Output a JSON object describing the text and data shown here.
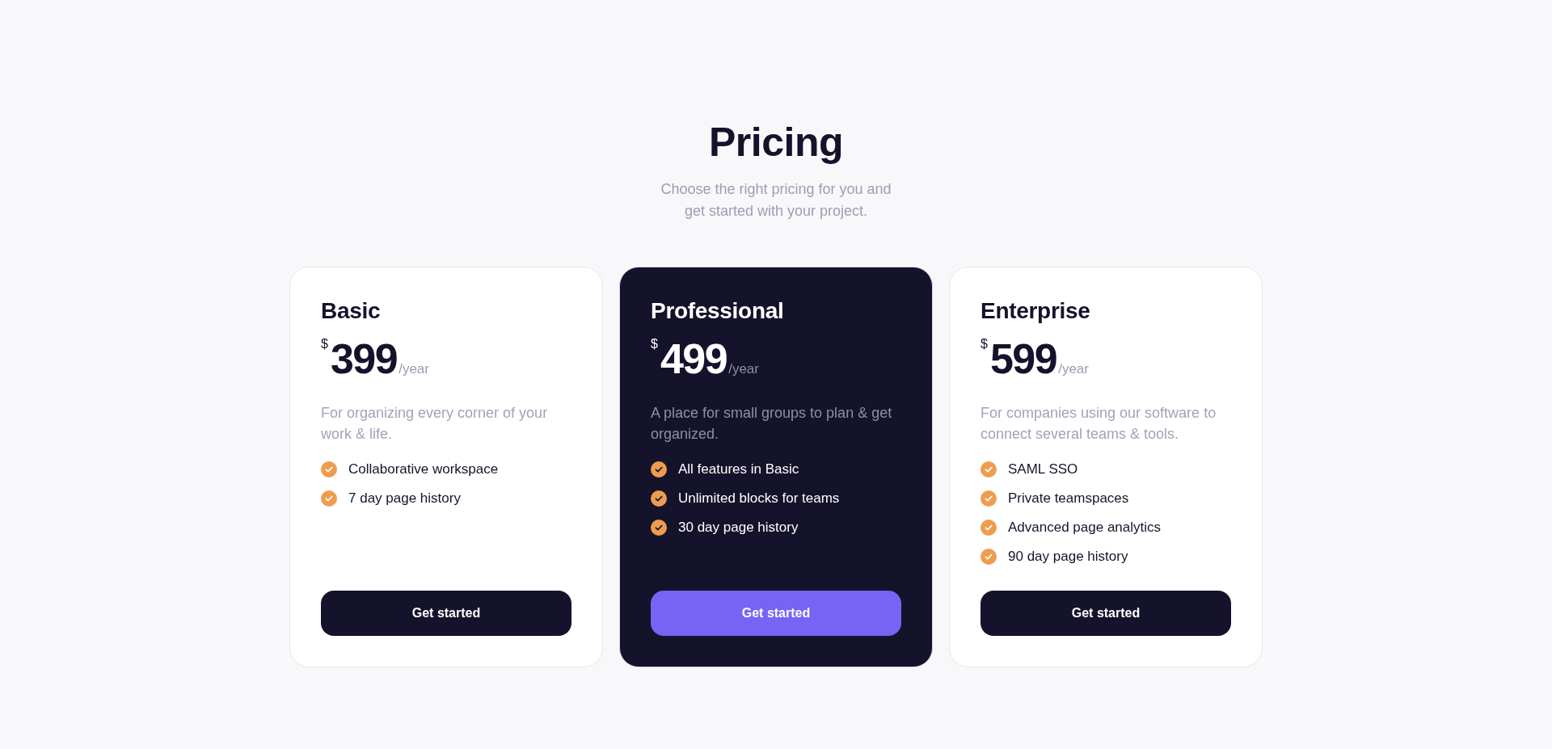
{
  "header": {
    "title": "Pricing",
    "subtitle": "Choose the right pricing for you and get started with your project."
  },
  "plans": [
    {
      "name": "Basic",
      "currency": "$",
      "price": "399",
      "period": "/year",
      "description": "For organizing every corner of your work & life.",
      "features": [
        "Collaborative workspace",
        "7 day page history"
      ],
      "button": "Get started",
      "highlighted": false
    },
    {
      "name": "Professional",
      "currency": "$",
      "price": "499",
      "period": "/year",
      "description": "A place for small groups to plan & get organized.",
      "features": [
        "All features in Basic",
        "Unlimited blocks for teams",
        "30 day page history"
      ],
      "button": "Get started",
      "highlighted": true
    },
    {
      "name": "Enterprise",
      "currency": "$",
      "price": "599",
      "period": "/year",
      "description": "For companies using our software to connect several teams & tools.",
      "features": [
        "SAML SSO",
        "Private teamspaces",
        "Advanced page analytics",
        "90 day page history"
      ],
      "button": "Get started",
      "highlighted": false
    }
  ]
}
